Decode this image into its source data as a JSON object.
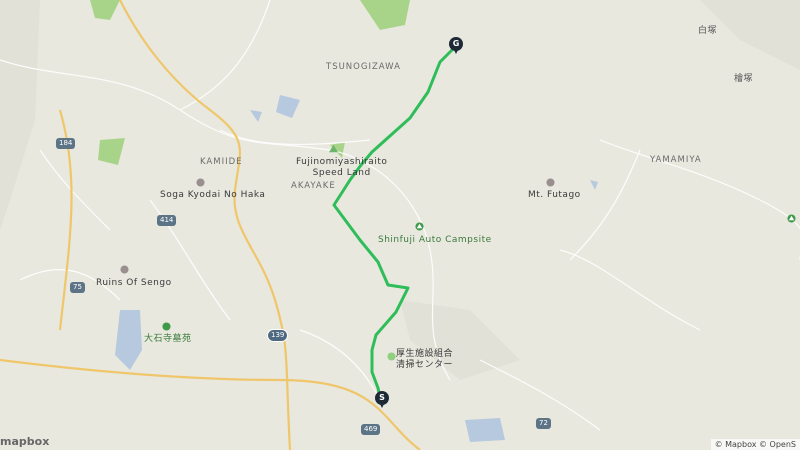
{
  "map": {
    "places": [
      {
        "id": "tsunogizawa",
        "label": "TSUNOGIZAWA"
      },
      {
        "id": "kamiide",
        "label": "KAMIIDE"
      },
      {
        "id": "akayake",
        "label": "AKAYAKE"
      },
      {
        "id": "yamamiya",
        "label": "YAMAMIYA"
      }
    ],
    "pois": [
      {
        "id": "fujinomiya",
        "label": "Fujinomiyashiraito\nSpeed Land"
      },
      {
        "id": "soga",
        "label": "Soga Kyodai No Haka"
      },
      {
        "id": "futago",
        "label": "Mt. Futago"
      },
      {
        "id": "shinfuji",
        "label": "Shinfuji Auto Campsite"
      },
      {
        "id": "sengo",
        "label": "Ruins Of Sengo"
      },
      {
        "id": "oishiji",
        "label": "大石寺墓苑"
      },
      {
        "id": "kosei",
        "label": "厚生施設組合\n清掃センター"
      },
      {
        "id": "shiratsuka",
        "label": "白塚"
      },
      {
        "id": "hinokizuka",
        "label": "檜塚"
      }
    ],
    "shields": [
      "184",
      "414",
      "75",
      "139",
      "469",
      "72"
    ],
    "markers": {
      "start": "S",
      "goal": "G"
    },
    "route_color": "#2ebd59",
    "attribution": "© Mapbox © OpenS",
    "logo": "mapbox"
  }
}
